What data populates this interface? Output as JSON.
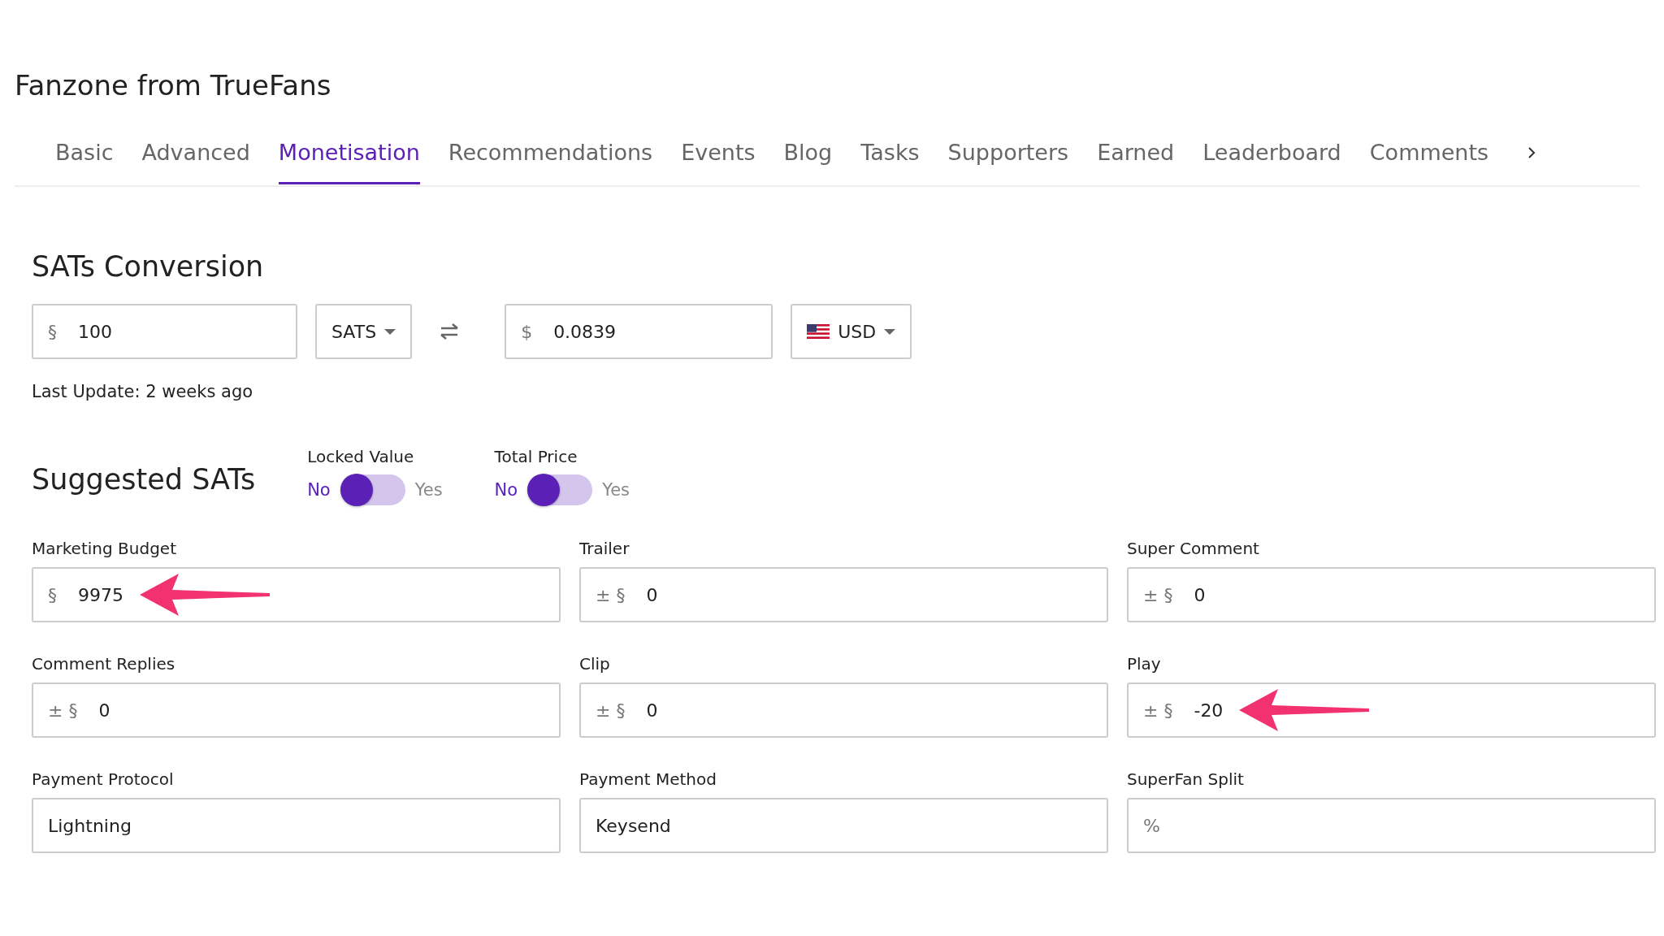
{
  "title": "Fanzone from TrueFans",
  "tabs": [
    {
      "label": "Basic",
      "selected": false
    },
    {
      "label": "Advanced",
      "selected": false
    },
    {
      "label": "Monetisation",
      "selected": true
    },
    {
      "label": "Recommendations",
      "selected": false
    },
    {
      "label": "Events",
      "selected": false
    },
    {
      "label": "Blog",
      "selected": false
    },
    {
      "label": "Tasks",
      "selected": false
    },
    {
      "label": "Supporters",
      "selected": false
    },
    {
      "label": "Earned",
      "selected": false
    },
    {
      "label": "Leaderboard",
      "selected": false
    },
    {
      "label": "Comments",
      "selected": false
    }
  ],
  "conversion": {
    "heading": "SATs Conversion",
    "sats_field": {
      "prefix": "§",
      "value": "100"
    },
    "sats_unit": "SATS",
    "fiat_field": {
      "prefix": "$",
      "value": "0.0839"
    },
    "currency": "USD",
    "last_update": "Last Update: 2 weeks ago"
  },
  "suggested": {
    "heading": "Suggested SATs",
    "toggles": [
      {
        "label": "Locked Value",
        "off_label": "No",
        "on_label": "Yes",
        "on": false
      },
      {
        "label": "Total Price",
        "off_label": "No",
        "on_label": "Yes",
        "on": false
      }
    ]
  },
  "fields": [
    {
      "label": "Marketing Budget",
      "prefix": "§",
      "value": "9975",
      "arrow": true
    },
    {
      "label": "Trailer",
      "prefix": "± §",
      "value": "0",
      "arrow": false
    },
    {
      "label": "Super Comment",
      "prefix": "± §",
      "value": "0",
      "arrow": false
    },
    {
      "label": "Comment Replies",
      "prefix": "± §",
      "value": "0",
      "arrow": false
    },
    {
      "label": "Clip",
      "prefix": "± §",
      "value": "0",
      "arrow": false
    },
    {
      "label": "Play",
      "prefix": "± §",
      "value": "-20",
      "arrow": true
    },
    {
      "label": "Payment Protocol",
      "value": "Lightning",
      "arrow": false
    },
    {
      "label": "Payment Method",
      "value": "Keysend",
      "arrow": false
    },
    {
      "label": "SuperFan Split",
      "prefix": "%",
      "arrow": false
    }
  ]
}
